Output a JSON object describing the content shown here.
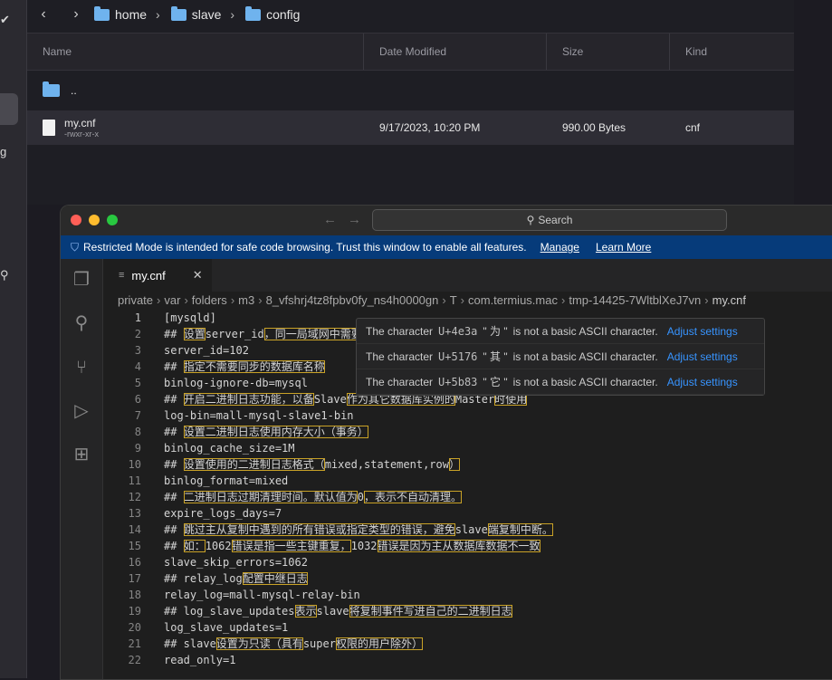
{
  "finder": {
    "path": [
      "home",
      "slave",
      "config"
    ],
    "columns": [
      "Name",
      "Date Modified",
      "Size",
      "Kind"
    ],
    "parent_row": "..",
    "file": {
      "name": "my.cnf",
      "perms": "-rwxr-xr-x",
      "date": "9/17/2023, 10:20 PM",
      "size": "990.00 Bytes",
      "kind": "cnf"
    }
  },
  "editor": {
    "search_placeholder": "Search",
    "banner": {
      "text": "Restricted Mode is intended for safe code browsing. Trust this window to enable all features.",
      "manage": "Manage",
      "learn_more": "Learn More"
    },
    "tab": "my.cnf",
    "breadcrumbs": [
      "private",
      "var",
      "folders",
      "m3",
      "8_vfshrj4tz8fpbv0fy_ns4h0000gn",
      "T",
      "com.termius.mac",
      "tmp-14425-7WltblXeJ7vn",
      "my.cnf"
    ],
    "lines": [
      "[mysqld]",
      "## 设置server_id，同一局域网中需要唯一",
      "server_id=102",
      "## 指定不需要同步的数据库名称",
      "binlog-ignore-db=mysql",
      "## 开启二进制日志功能，以备Slave作为其它数据库实例的Master时使用",
      "log-bin=mall-mysql-slave1-bin",
      "## 设置二进制日志使用内存大小（事务）",
      "binlog_cache_size=1M",
      "## 设置使用的二进制日志格式（mixed,statement,row）",
      "binlog_format=mixed",
      "## 二进制日志过期清理时间。默认值为0，表示不自动清理。",
      "expire_logs_days=7",
      "## 跳过主从复制中遇到的所有错误或指定类型的错误，避免slave端复制中断。",
      "## 如：1062错误是指一些主键重复，1032错误是因为主从数据库数据不一致",
      "slave_skip_errors=1062",
      "## relay_log配置中继日志",
      "relay_log=mall-mysql-relay-bin",
      "## log_slave_updates表示slave将复制事件写进自己的二进制日志",
      "log_slave_updates=1",
      "## slave设置为只读（具有super权限的用户除外）",
      "read_only=1"
    ],
    "hover": [
      {
        "prefix": "The character",
        "code": "U+4e3a",
        "char": "\" 为 \"",
        "suffix": "is not a basic ASCII character.",
        "action": "Adjust settings"
      },
      {
        "prefix": "The character",
        "code": "U+5176",
        "char": "\" 其 \"",
        "suffix": "is not a basic ASCII character.",
        "action": "Adjust settings"
      },
      {
        "prefix": "The character",
        "code": "U+5b83",
        "char": "\" 它 \"",
        "suffix": "is not a basic ASCII character.",
        "action": "Adjust settings"
      }
    ]
  },
  "colors": {
    "banner": "#063b7a",
    "highlight": "#c9a227",
    "link": "#3794ff"
  }
}
